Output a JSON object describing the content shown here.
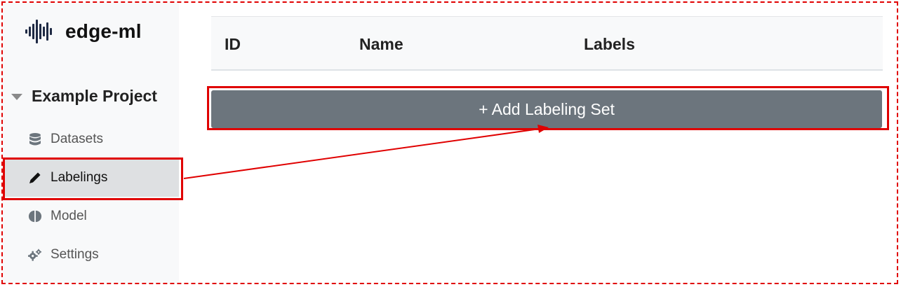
{
  "app": {
    "name": "edge-ml",
    "logo_icon": "waveform-icon"
  },
  "sidebar": {
    "project": {
      "name": "Example Project",
      "expanded": true
    },
    "items": [
      {
        "label": "Datasets",
        "icon": "database-icon",
        "active": false
      },
      {
        "label": "Labelings",
        "icon": "pencil-icon",
        "active": true
      },
      {
        "label": "Model",
        "icon": "brain-icon",
        "active": false
      },
      {
        "label": "Settings",
        "icon": "gears-icon",
        "active": false
      }
    ]
  },
  "table": {
    "columns": [
      "ID",
      "Name",
      "Labels"
    ]
  },
  "actions": {
    "add_labeling_set": "+ Add Labeling Set"
  },
  "colors": {
    "highlight": "#e00000",
    "button": "#6c757d",
    "active_nav": "#dee0e2"
  }
}
